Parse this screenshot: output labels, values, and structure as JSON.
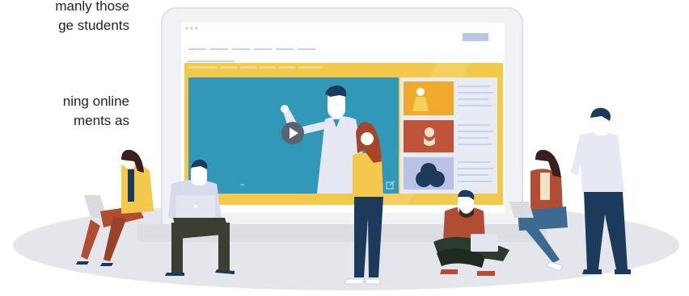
{
  "intro_text": {
    "paragraph_1": [
      "manly   those",
      "ge students"
    ],
    "paragraph_2": [
      "ning  online",
      "ments   as"
    ]
  },
  "video_player": {
    "play_icon": "play-icon",
    "expand_icon": "external-link-icon"
  },
  "colors": {
    "platform": "#e5e5ec",
    "laptop_frame": "#f1f2f5",
    "banner_yellow": "#f2c94c",
    "video_teal": "#3198b8",
    "sidebar_bg": "#e6ebf4",
    "thumb_orange": "#f0a92a",
    "thumb_brown": "#c0543a",
    "thumb_lavender": "#b9c2e4",
    "navy": "#1c3a5c",
    "shirt_light": "#e6e8f4"
  }
}
